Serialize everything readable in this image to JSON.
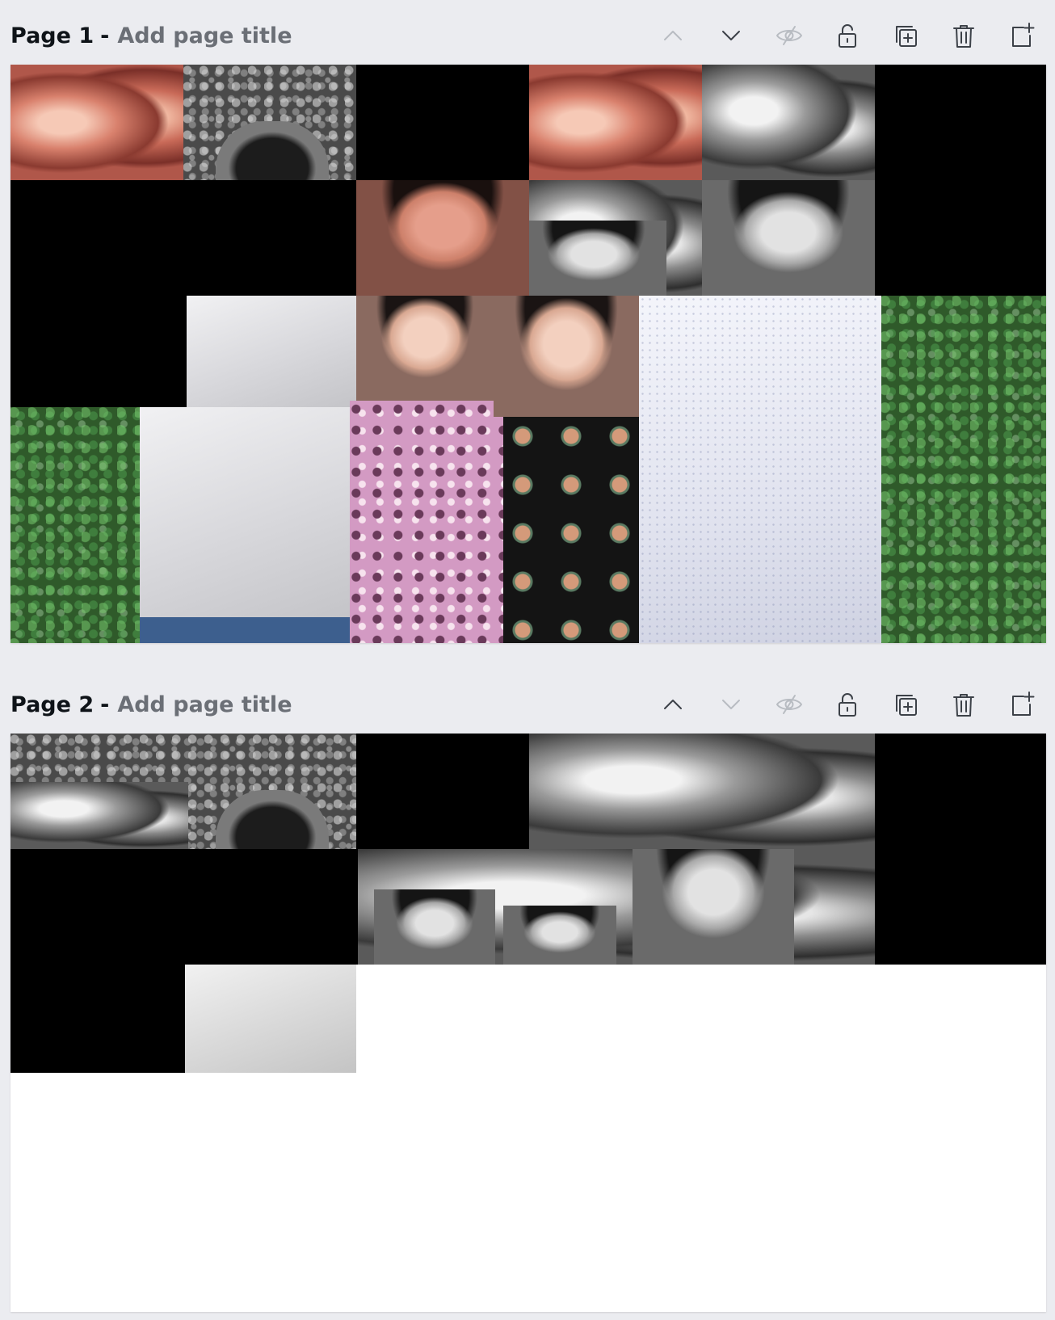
{
  "pages": [
    {
      "number": "Page 1",
      "separator": "-",
      "title_placeholder": "Add page title",
      "toolbar": {
        "move_up": {
          "icon": "chevron-up-icon",
          "enabled": false
        },
        "move_down": {
          "icon": "chevron-down-icon",
          "enabled": true
        },
        "hide": {
          "icon": "eye-slash-icon",
          "enabled": false
        },
        "lock": {
          "icon": "unlock-icon",
          "enabled": true
        },
        "duplicate": {
          "icon": "duplicate-page-icon",
          "enabled": true
        },
        "delete": {
          "icon": "trash-icon",
          "enabled": true
        },
        "add": {
          "icon": "add-page-icon",
          "enabled": true
        }
      }
    },
    {
      "number": "Page 2",
      "separator": "-",
      "title_placeholder": "Add page title",
      "toolbar": {
        "move_up": {
          "icon": "chevron-up-icon",
          "enabled": true
        },
        "move_down": {
          "icon": "chevron-down-icon",
          "enabled": false
        },
        "hide": {
          "icon": "eye-slash-icon",
          "enabled": false
        },
        "lock": {
          "icon": "unlock-icon",
          "enabled": true
        },
        "duplicate": {
          "icon": "duplicate-page-icon",
          "enabled": true
        },
        "delete": {
          "icon": "trash-icon",
          "enabled": true
        },
        "add": {
          "icon": "add-page-icon",
          "enabled": true
        }
      }
    }
  ],
  "colors": {
    "workspace_bg": "#ebecf0",
    "page_bg": "#ffffff",
    "title_text": "#0e1318",
    "placeholder_text": "#6b6f76",
    "icon_enabled": "#3c4148",
    "icon_disabled": "#b8bcc2",
    "puzzle_blank": "#000000",
    "pink_highlight": "#d9816d"
  }
}
